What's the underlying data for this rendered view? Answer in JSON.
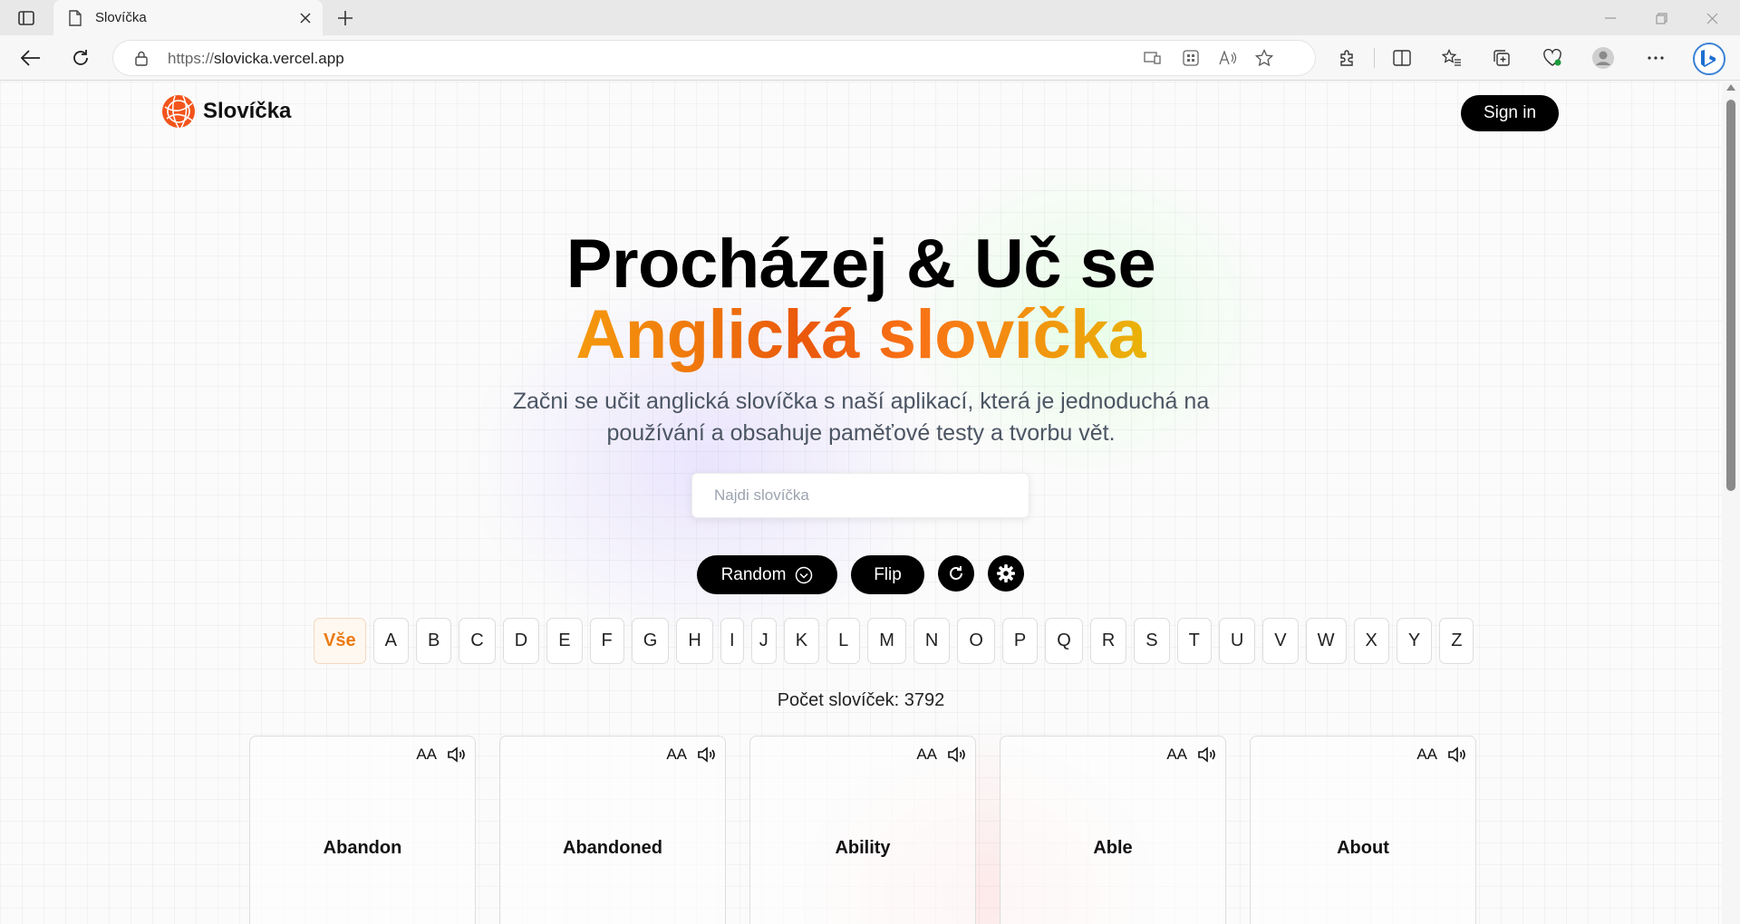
{
  "browser": {
    "tab_title": "Slovíčka",
    "url_protocol": "https://",
    "url_host": "slovicka.vercel.app"
  },
  "site": {
    "logo_text": "Slovíčka",
    "signin_label": "Sign in",
    "hero_line1": "Procházej & Uč se",
    "hero_line2": "Anglická slovíčka",
    "subtitle": "Začni se učit anglická slovíčka s naší aplikací, která je jednoduchá na používání a obsahuje paměťové testy a tvorbu vět.",
    "search_placeholder": "Najdi slovíčka",
    "random_label": "Random",
    "flip_label": "Flip",
    "letters": [
      "Vše",
      "A",
      "B",
      "C",
      "D",
      "E",
      "F",
      "G",
      "H",
      "I",
      "J",
      "K",
      "L",
      "M",
      "N",
      "O",
      "P",
      "Q",
      "R",
      "S",
      "T",
      "U",
      "V",
      "W",
      "X",
      "Y",
      "Z"
    ],
    "count_label": "Počet slovíček: 3792",
    "cards": [
      {
        "word": "Abandon",
        "aa": "AA"
      },
      {
        "word": "Abandoned",
        "aa": "AA"
      },
      {
        "word": "Ability",
        "aa": "AA"
      },
      {
        "word": "Able",
        "aa": "AA"
      },
      {
        "word": "About",
        "aa": "AA"
      }
    ],
    "colors": {
      "accent_orange": "#ea580c",
      "accent_amber": "#eab308",
      "button_bg": "#000000"
    }
  }
}
